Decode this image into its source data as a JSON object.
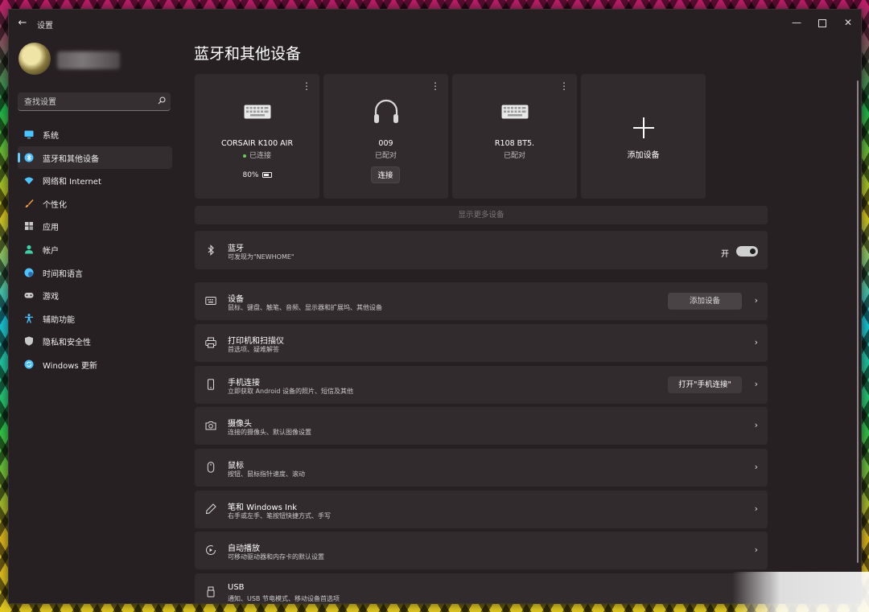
{
  "window": {
    "title": "设置"
  },
  "search": {
    "placeholder": "查找设置"
  },
  "sidebar": {
    "items": [
      {
        "label": "系统",
        "icon": "monitor-icon",
        "color": "#4cc2ff"
      },
      {
        "label": "蓝牙和其他设备",
        "icon": "bluetooth-icon",
        "color": "#4cc2ff",
        "active": true
      },
      {
        "label": "网络和 Internet",
        "icon": "wifi-icon",
        "color": "#4cc2ff"
      },
      {
        "label": "个性化",
        "icon": "brush-icon",
        "color": "#f7a34a"
      },
      {
        "label": "应用",
        "icon": "apps-icon",
        "color": "#c9c9c9"
      },
      {
        "label": "帐户",
        "icon": "person-icon",
        "color": "#3cd0a4"
      },
      {
        "label": "时间和语言",
        "icon": "globe-clock-icon",
        "color": "#4cc2ff"
      },
      {
        "label": "游戏",
        "icon": "gamepad-icon",
        "color": "#c9c9c9"
      },
      {
        "label": "辅助功能",
        "icon": "accessibility-icon",
        "color": "#4cc2ff"
      },
      {
        "label": "隐私和安全性",
        "icon": "shield-icon",
        "color": "#c9c9c9"
      },
      {
        "label": "Windows 更新",
        "icon": "update-icon",
        "color": "#4cc2ff"
      }
    ]
  },
  "main": {
    "title": "蓝牙和其他设备",
    "devices": [
      {
        "name": "CORSAIR K100 AIR",
        "status": "已连接",
        "battery": "80%",
        "icon": "keyboard-icon"
      },
      {
        "name": "009",
        "status": "已配对",
        "button": "连接",
        "icon": "headphones-icon"
      },
      {
        "name": "R108 BT5.",
        "status": "已配对",
        "icon": "keyboard-icon"
      }
    ],
    "add_device_tile": "添加设备",
    "show_more": "显示更多设备",
    "bluetooth": {
      "title": "蓝牙",
      "subtitle": "可发现为\"NEWHOME\"",
      "toggle_label": "开",
      "on": true
    },
    "rows": [
      {
        "title": "设备",
        "subtitle": "鼠标、键盘、触笔、音频、显示器和扩展坞、其他设备",
        "button": "添加设备",
        "icon": "devices-icon"
      },
      {
        "title": "打印机和扫描仪",
        "subtitle": "首选项、疑难解答",
        "icon": "printer-icon"
      },
      {
        "title": "手机连接",
        "subtitle": "立即获取 Android 设备的照片、短信及其他",
        "button": "打开\"手机连接\"",
        "icon": "phone-icon"
      },
      {
        "title": "摄像头",
        "subtitle": "连接的摄像头、默认图像设置",
        "icon": "camera-icon"
      },
      {
        "title": "鼠标",
        "subtitle": "按钮、鼠标指针速度、滚动",
        "icon": "mouse-icon"
      },
      {
        "title": "笔和 Windows Ink",
        "subtitle": "右手或左手、笔按钮快捷方式、手写",
        "icon": "pen-icon"
      },
      {
        "title": "自动播放",
        "subtitle": "可移动驱动器和内存卡的默认设置",
        "icon": "autoplay-icon"
      },
      {
        "title": "USB",
        "subtitle": "通知、USB 节电模式、移动设备首选项",
        "icon": "usb-icon"
      }
    ]
  },
  "colors": {
    "accent": "#60cdff",
    "connected": "#6ccb5f"
  }
}
